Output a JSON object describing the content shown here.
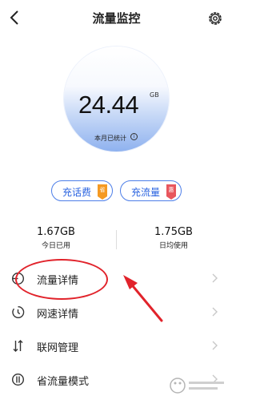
{
  "header": {
    "title": "流量监控",
    "back_icon": "chevron-left-icon",
    "settings_icon": "gear-icon"
  },
  "gauge": {
    "value": "24.44",
    "unit": "GB",
    "caption": "本月已统计",
    "info_icon": "info-icon"
  },
  "buttons": {
    "recharge_call": {
      "label": "充话费",
      "tag": "省",
      "tag_color": "#f59a23"
    },
    "recharge_data": {
      "label": "充流量",
      "tag": "惠",
      "tag_color": "#e8565d"
    }
  },
  "stats": {
    "today": {
      "value": "1.67GB",
      "label": "今日已用"
    },
    "daily_avg": {
      "value": "1.75GB",
      "label": "日均使用"
    }
  },
  "menu": [
    {
      "label": "流量详情",
      "icon": "pie-chart-icon"
    },
    {
      "label": "网速详情",
      "icon": "speed-clock-icon"
    },
    {
      "label": "联网管理",
      "icon": "updown-arrows-icon"
    },
    {
      "label": "省流量模式",
      "icon": "save-data-icon"
    }
  ],
  "colors": {
    "accent_blue": "#2a63e0",
    "annotation_red": "#e1232b"
  }
}
